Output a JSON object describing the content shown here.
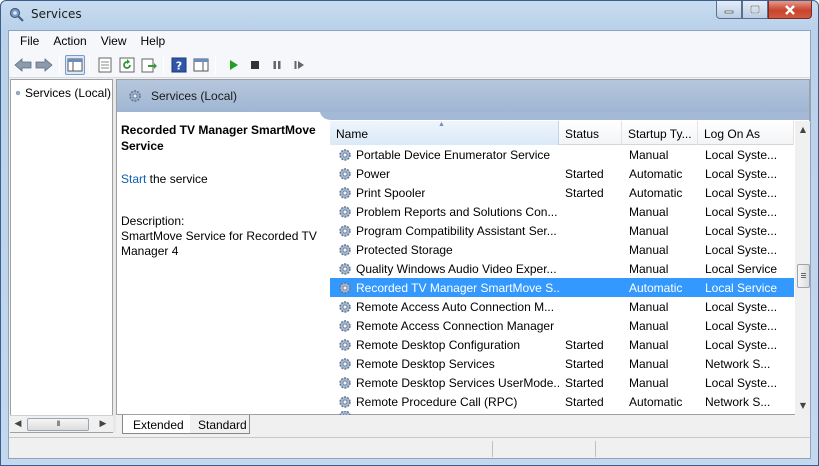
{
  "window": {
    "title": "Services",
    "icon": "gear-search-icon"
  },
  "menu": [
    "File",
    "Action",
    "View",
    "Help"
  ],
  "toolbar": {
    "buttons": [
      "back-icon",
      "forward-icon",
      "show-hide-console-tree-icon",
      "properties-icon",
      "refresh-icon",
      "export-list-icon",
      "help-icon",
      "action-pane-icon",
      "start-service-icon",
      "stop-service-icon",
      "pause-service-icon",
      "resume-service-icon"
    ]
  },
  "tree": {
    "item_label": "Services (Local)"
  },
  "header": {
    "title": "Services (Local)"
  },
  "detail": {
    "service_title": "Recorded TV Manager SmartMove Service",
    "start_link": "Start",
    "start_suffix": " the service",
    "description_label": "Description:",
    "description": "SmartMove Service for Recorded TV Manager 4"
  },
  "columns": {
    "name": "Name",
    "status": "Status",
    "startup": "Startup Ty...",
    "logon": "Log On As"
  },
  "services": [
    {
      "name": "Portable Device Enumerator Service",
      "status": "",
      "startup": "Manual",
      "logon": "Local Syste..."
    },
    {
      "name": "Power",
      "status": "Started",
      "startup": "Automatic",
      "logon": "Local Syste..."
    },
    {
      "name": "Print Spooler",
      "status": "Started",
      "startup": "Automatic",
      "logon": "Local Syste..."
    },
    {
      "name": "Problem Reports and Solutions Con...",
      "status": "",
      "startup": "Manual",
      "logon": "Local Syste..."
    },
    {
      "name": "Program Compatibility Assistant Ser...",
      "status": "",
      "startup": "Manual",
      "logon": "Local Syste..."
    },
    {
      "name": "Protected Storage",
      "status": "",
      "startup": "Manual",
      "logon": "Local Syste..."
    },
    {
      "name": "Quality Windows Audio Video Exper...",
      "status": "",
      "startup": "Manual",
      "logon": "Local Service"
    },
    {
      "name": "Recorded TV Manager SmartMove S...",
      "status": "",
      "startup": "Automatic",
      "logon": "Local Service",
      "selected": true
    },
    {
      "name": "Remote Access Auto Connection M...",
      "status": "",
      "startup": "Manual",
      "logon": "Local Syste..."
    },
    {
      "name": "Remote Access Connection Manager",
      "status": "",
      "startup": "Manual",
      "logon": "Local Syste..."
    },
    {
      "name": "Remote Desktop Configuration",
      "status": "Started",
      "startup": "Manual",
      "logon": "Local Syste..."
    },
    {
      "name": "Remote Desktop Services",
      "status": "Started",
      "startup": "Manual",
      "logon": "Network S..."
    },
    {
      "name": "Remote Desktop Services UserMode...",
      "status": "Started",
      "startup": "Manual",
      "logon": "Local Syste..."
    },
    {
      "name": "Remote Procedure Call (RPC)",
      "status": "Started",
      "startup": "Automatic",
      "logon": "Network S..."
    },
    {
      "name": "",
      "status": "",
      "startup": "",
      "logon": ""
    }
  ],
  "tabs": [
    "Extended",
    "Standard"
  ],
  "colors": {
    "selection": "#3399ff",
    "header_band": "#a9bdd8",
    "link": "#0b60b0"
  }
}
